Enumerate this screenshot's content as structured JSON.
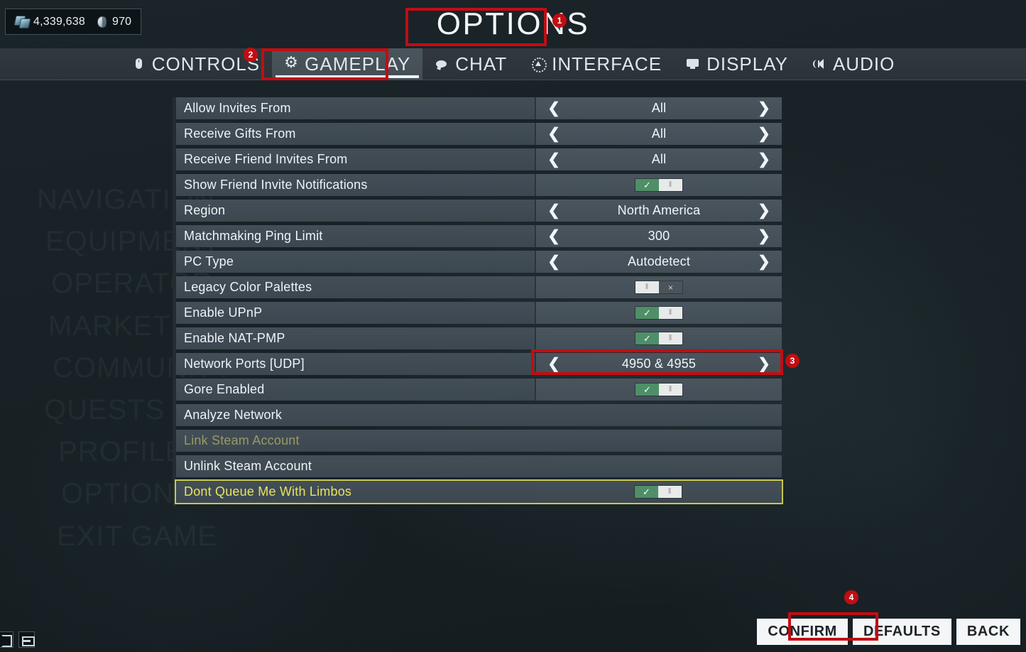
{
  "currency": {
    "credits_icon": "credits-icon",
    "credits": "4,339,638",
    "platinum_icon": "platinum-icon",
    "platinum": "970"
  },
  "header": {
    "title": "OPTIONS"
  },
  "tabs": [
    {
      "label": "CONTROLS",
      "icon": "mouse-icon",
      "active": false
    },
    {
      "label": "GAMEPLAY",
      "icon": "gear-icon",
      "active": true
    },
    {
      "label": "CHAT",
      "icon": "chat-icon",
      "active": false
    },
    {
      "label": "INTERFACE",
      "icon": "interface-icon",
      "active": false
    },
    {
      "label": "DISPLAY",
      "icon": "monitor-icon",
      "active": false
    },
    {
      "label": "AUDIO",
      "icon": "speaker-icon",
      "active": false
    }
  ],
  "settings": [
    {
      "label": "Allow Invites From",
      "control": "selector",
      "value": "All"
    },
    {
      "label": "Receive Gifts From",
      "control": "selector",
      "value": "All"
    },
    {
      "label": "Receive Friend Invites From",
      "control": "selector",
      "value": "All"
    },
    {
      "label": "Show Friend Invite Notifications",
      "control": "toggle",
      "value": "on"
    },
    {
      "label": "Region",
      "control": "selector",
      "value": "North America"
    },
    {
      "label": "Matchmaking Ping Limit",
      "control": "selector",
      "value": "300"
    },
    {
      "label": "PC Type",
      "control": "selector",
      "value": "Autodetect"
    },
    {
      "label": "Legacy Color Palettes",
      "control": "toggle",
      "value": "off"
    },
    {
      "label": "Enable UPnP",
      "control": "toggle",
      "value": "on"
    },
    {
      "label": "Enable NAT-PMP",
      "control": "toggle",
      "value": "on"
    },
    {
      "label": "Network Ports [UDP]",
      "control": "selector",
      "value": "4950 & 4955"
    },
    {
      "label": "Gore Enabled",
      "control": "toggle",
      "value": "on"
    },
    {
      "label": "Analyze Network",
      "control": "action",
      "value": ""
    },
    {
      "label": "Link Steam Account",
      "control": "action",
      "value": "",
      "state": "disabled"
    },
    {
      "label": "Unlink Steam Account",
      "control": "action",
      "value": ""
    },
    {
      "label": "Dont Queue Me With Limbos",
      "control": "toggle",
      "value": "on",
      "state": "highlighted"
    }
  ],
  "toggle_glyphs": {
    "check": "✓",
    "grip": "‖",
    "cross": "×"
  },
  "arrows": {
    "left": "❮",
    "right": "❯"
  },
  "buttons": [
    {
      "label": "CONFIRM"
    },
    {
      "label": "DEFAULTS"
    },
    {
      "label": "BACK"
    }
  ],
  "corner_icons": [
    {
      "name": "bracket-icon"
    },
    {
      "name": "window-icon"
    }
  ],
  "background_menu": [
    "NAVIGATION",
    "EQUIPMENT",
    "OPERATOR",
    "MARKET",
    "COMMUNITY",
    "QUESTS",
    "PROFILE",
    "OPTIONS",
    "EXIT GAME"
  ],
  "annotations": [
    {
      "id": "1",
      "target": "page-title"
    },
    {
      "id": "2",
      "target": "tab-controls"
    },
    {
      "id": "3",
      "target": "network-ports-value"
    },
    {
      "id": "4",
      "target": "confirm-button"
    }
  ],
  "colors": {
    "accent_annotation": "#c20d12",
    "toggle_on": "#4e8f68",
    "highlight_border": "#c7c84f",
    "highlight_text": "#e6e45e",
    "row_bg": "#3f4a53",
    "page_bg": "#1b2429"
  }
}
